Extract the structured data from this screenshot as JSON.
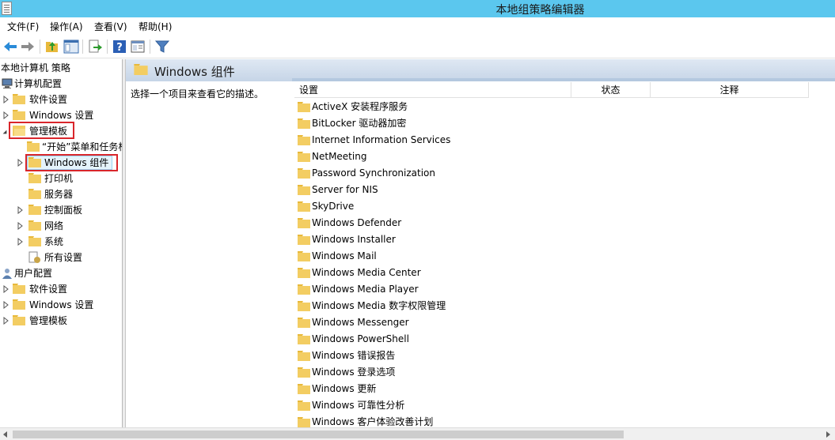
{
  "window": {
    "title": "本地组策略编辑器"
  },
  "menu": [
    "文件(F)",
    "操作(A)",
    "查看(V)",
    "帮助(H)"
  ],
  "toolbar": {
    "icons": [
      "back-arrow-icon",
      "forward-arrow-icon",
      "up-folder-icon",
      "show-hide-tree-icon",
      "export-list-icon",
      "help-icon",
      "properties-icon",
      "filter-icon"
    ]
  },
  "tree": {
    "root": "本地计算机 策略",
    "computer_config": "计算机配置",
    "items": [
      {
        "label": "软件设置"
      },
      {
        "label": "Windows 设置"
      },
      {
        "label": "管理模板"
      },
      {
        "label": "“开始”菜单和任务栏"
      },
      {
        "label": "Windows 组件"
      },
      {
        "label": "打印机"
      },
      {
        "label": "服务器"
      },
      {
        "label": "控制面板"
      },
      {
        "label": "网络"
      },
      {
        "label": "系统"
      },
      {
        "label": "所有设置"
      }
    ],
    "user_config": "用户配置",
    "user_items": [
      {
        "label": "软件设置"
      },
      {
        "label": "Windows 设置"
      },
      {
        "label": "管理模板"
      }
    ]
  },
  "content": {
    "header_title": "Windows 组件",
    "description": "选择一个项目来查看它的描述。",
    "columns": [
      "设置",
      "状态",
      "注释"
    ],
    "rows": [
      "ActiveX 安装程序服务",
      "BitLocker 驱动器加密",
      "Internet Information Services",
      "NetMeeting",
      "Password Synchronization",
      "Server for NIS",
      "SkyDrive",
      "Windows Defender",
      "Windows Installer",
      "Windows Mail",
      "Windows Media Center",
      "Windows Media Player",
      "Windows Media 数字权限管理",
      "Windows Messenger",
      "Windows PowerShell",
      "Windows 错误报告",
      "Windows 登录选项",
      "Windows 更新",
      "Windows 可靠性分析",
      "Windows 客户体验改善计划"
    ]
  },
  "colors": {
    "titlebar": "#5bc7ee",
    "highlight_box": "#d9262b",
    "folder": "#f3cd62"
  }
}
